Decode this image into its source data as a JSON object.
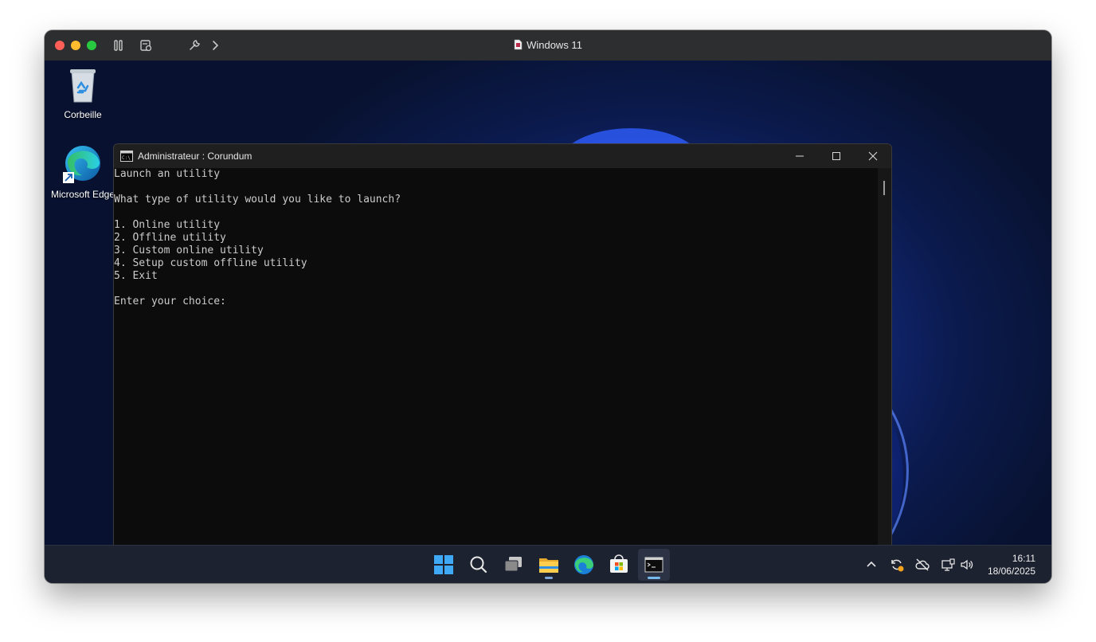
{
  "mac_window": {
    "title": "Windows 11",
    "toolbar_icons": [
      "pause-icon",
      "snapshot-icon",
      "wrench-icon",
      "chevron-right-icon"
    ]
  },
  "desktop": {
    "icons": [
      {
        "label": "Corbeille",
        "icon": "recycle-bin-icon"
      },
      {
        "label": "Microsoft Edge",
        "icon": "edge-icon"
      }
    ]
  },
  "cmd_window": {
    "title": "Administrateur : Corundum",
    "lines": [
      "Launch an utility",
      "",
      "What type of utility would you like to launch?",
      "",
      "1. Online utility",
      "2. Offline utility",
      "3. Custom online utility",
      "4. Setup custom offline utility",
      "5. Exit",
      "",
      "Enter your choice:"
    ]
  },
  "taskbar": {
    "apps": [
      {
        "name": "start",
        "icon": "windows-start-icon"
      },
      {
        "name": "search",
        "icon": "search-icon"
      },
      {
        "name": "task-view",
        "icon": "task-view-icon"
      },
      {
        "name": "file-explorer",
        "icon": "folder-icon",
        "running": true
      },
      {
        "name": "edge",
        "icon": "edge-icon"
      },
      {
        "name": "store",
        "icon": "store-icon"
      },
      {
        "name": "terminal",
        "icon": "terminal-icon",
        "running": true,
        "active": true
      }
    ],
    "tray_icons": [
      "chevron-up-icon",
      "sync-icon",
      "cloud-off-icon",
      "network-icon",
      "volume-icon"
    ],
    "time": "16:11",
    "date": "18/06/2025"
  }
}
